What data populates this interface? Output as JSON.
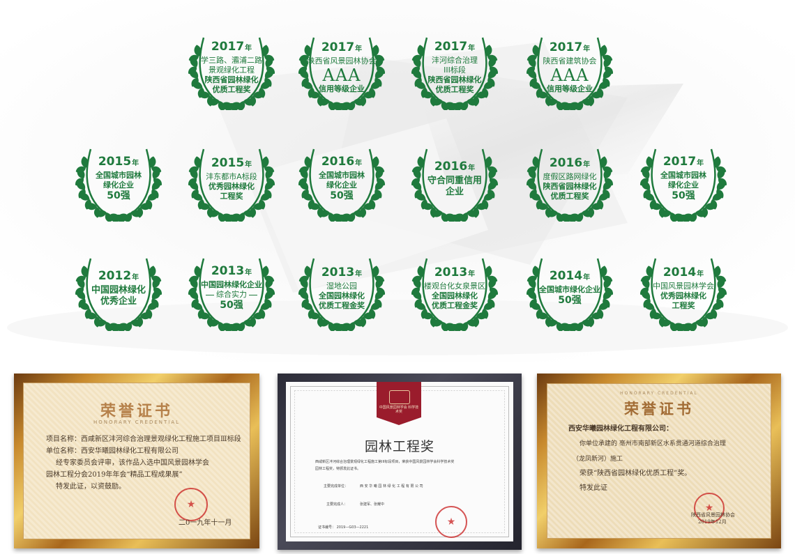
{
  "colors": {
    "award_green": "#1f7a3d",
    "gold_frame": "#c88a2e",
    "certificate_red": "#9a1c2c"
  },
  "awards": [
    {
      "year": "2017",
      "nian": "年",
      "lines": [
        {
          "t": "学三路、灞浦二路",
          "s": ""
        },
        {
          "t": "景观绿化工程",
          "s": ""
        },
        {
          "t": "陕西省园林绿化",
          "s": "b"
        },
        {
          "t": "优质工程奖",
          "s": "b"
        }
      ]
    },
    {
      "year": "2017",
      "nian": "年",
      "lines": [
        {
          "t": "陕西省风景园林协会",
          "s": ""
        },
        {
          "t": "AAA",
          "s": "aaa"
        },
        {
          "t": "信用等级企业",
          "s": "b"
        }
      ]
    },
    {
      "year": "2017",
      "nian": "年",
      "lines": [
        {
          "t": "沣河综合治理",
          "s": ""
        },
        {
          "t": "III标段",
          "s": ""
        },
        {
          "t": "陕西省园林绿化",
          "s": "b"
        },
        {
          "t": "优质工程奖",
          "s": "b"
        }
      ]
    },
    {
      "year": "2017",
      "nian": "年",
      "lines": [
        {
          "t": "陕西省建筑协会",
          "s": ""
        },
        {
          "t": "AAA",
          "s": "aaa"
        },
        {
          "t": "信用等级企业",
          "s": "b"
        }
      ]
    },
    {
      "year": "2015",
      "nian": "年",
      "lines": [
        {
          "t": "全国城市园林",
          "s": "b"
        },
        {
          "t": "绿化企业",
          "s": "b"
        },
        {
          "t": "50强",
          "s": "n"
        }
      ]
    },
    {
      "year": "2015",
      "nian": "年",
      "lines": [
        {
          "t": "沣东都市A标段",
          "s": ""
        },
        {
          "t": "优秀园林绿化",
          "s": "b"
        },
        {
          "t": "工程奖",
          "s": "b"
        }
      ]
    },
    {
      "year": "2016",
      "nian": "年",
      "lines": [
        {
          "t": "全国城市园林",
          "s": "b"
        },
        {
          "t": "绿化企业",
          "s": "b"
        },
        {
          "t": "50强",
          "s": "n"
        }
      ]
    },
    {
      "year": "2016",
      "nian": "年",
      "lines": [
        {
          "t": "守合同重信用",
          "s": "l"
        },
        {
          "t": "企业",
          "s": "l"
        }
      ]
    },
    {
      "year": "2016",
      "nian": "年",
      "lines": [
        {
          "t": "度假区路网绿化",
          "s": ""
        },
        {
          "t": "陕西省园林绿化",
          "s": "b"
        },
        {
          "t": "优质工程奖",
          "s": "b"
        }
      ]
    },
    {
      "year": "2017",
      "nian": "年",
      "lines": [
        {
          "t": "全国城市园林",
          "s": "b"
        },
        {
          "t": "绿化企业",
          "s": "b"
        },
        {
          "t": "50强",
          "s": "n"
        }
      ]
    },
    {
      "year": "2012",
      "nian": "年",
      "lines": [
        {
          "t": "中国园林绿化",
          "s": "l"
        },
        {
          "t": "优秀企业",
          "s": "l"
        }
      ]
    },
    {
      "year": "2013",
      "nian": "年",
      "lines": [
        {
          "t": "中国园林绿化企业",
          "s": "b"
        },
        {
          "t": "综合实力",
          "s": "sep"
        },
        {
          "t": "50强",
          "s": "n"
        }
      ]
    },
    {
      "year": "2013",
      "nian": "年",
      "lines": [
        {
          "t": "湿地公园",
          "s": ""
        },
        {
          "t": "全国园林绿化",
          "s": "b"
        },
        {
          "t": "优质工程金奖",
          "s": "b"
        }
      ]
    },
    {
      "year": "2013",
      "nian": "年",
      "lines": [
        {
          "t": "楼观台化女泉景区",
          "s": ""
        },
        {
          "t": "全国园林绿化",
          "s": "b"
        },
        {
          "t": "优质工程金奖",
          "s": "b"
        }
      ]
    },
    {
      "year": "2014",
      "nian": "年",
      "lines": [
        {
          "t": "全国城市绿化企业",
          "s": "b"
        },
        {
          "t": "50强",
          "s": "n"
        }
      ]
    },
    {
      "year": "2014",
      "nian": "年",
      "lines": [
        {
          "t": "中国风景园林学会",
          "s": ""
        },
        {
          "t": "优秀园林绿化",
          "s": "b"
        },
        {
          "t": "工程奖",
          "s": "b"
        }
      ]
    }
  ],
  "certificates": {
    "left": {
      "title": "荣誉证书",
      "subtitle": "HONORARY  CREDENTIAL",
      "lines": [
        "项目名称：西咸新区沣河综合治理景观绿化工程施工项目Ⅲ标段",
        "单位名称：西安华曦园林绿化工程有限公司",
        "经专家委员会评审，该作品入选中国风景园林学会",
        "园林工程分会2019年年会“精品工程成果展”",
        "特发此证，以资鼓励。"
      ],
      "date": "二0一九年十一月"
    },
    "middle": {
      "ribbon": "中国风景园林学会 科学技术奖",
      "title": "园林工程奖",
      "body": "西咸新区沣河综合治理景观绿化工程施工第III标段项目，荣获中国风景园林学会科学技术奖",
      "body2": "园林工程奖，特颁发此证书。",
      "unit_label": "主要完成单位：",
      "unit_value": "西 安 华 曦 园 林 绿 化 工 程 有 限 公 司",
      "people_label": "主要完成人：",
      "people_value": "张建军、张耀中",
      "cert_no": "证书编号： 2019—G03—2221"
    },
    "right": {
      "title": "荣誉证书",
      "subtitle": "HONORARY CREDENTIAL",
      "lines": [
        "西安华曦园林绿化工程有限公司：",
        "你单位承建的   亳州市南部新区水系贯通河道综合治理",
        "（龙凤新河）施工",
        "荣获“陕西省园林绿化优质工程”奖。",
        "特发此证"
      ],
      "issuer": "陕西省风景园林协会",
      "date": "2019年12月"
    }
  }
}
